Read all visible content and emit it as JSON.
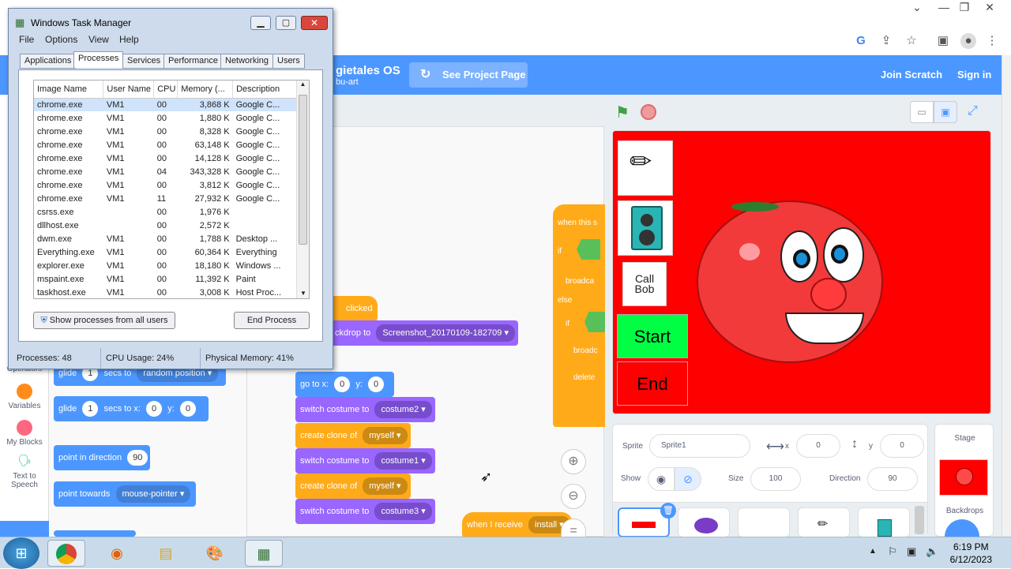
{
  "browser": {
    "toolbar_icons": [
      "google-icon",
      "share-icon",
      "star-icon",
      "sidebar-icon",
      "profile-icon",
      "menu-icon"
    ]
  },
  "scratch": {
    "project_title": "gietales OS",
    "project_author": "bu-art",
    "see_project": "See Project Page",
    "join": "Join Scratch",
    "signin": "Sign in",
    "categories": [
      {
        "label": "Operators",
        "color": "#59c059"
      },
      {
        "label": "Variables",
        "color": "#ff8c1a"
      },
      {
        "label": "My Blocks",
        "color": "#ff6680"
      },
      {
        "label": "Text to Speech",
        "color": "#0fbd8c"
      }
    ],
    "palette_blocks": {
      "glide1": {
        "label": "glide",
        "secs": "1",
        "secs_to": "secs to",
        "target": "random position"
      },
      "glide2": {
        "label": "glide",
        "secs": "1",
        "secs_to": "secs to x:",
        "x": "0",
        "y_label": "y:",
        "y": "0"
      },
      "point_dir": {
        "label": "point in direction",
        "value": "90"
      },
      "point_towards": {
        "label": "point towards",
        "target": "mouse-pointer"
      }
    },
    "script_blocks": {
      "clicked": "clicked",
      "backdrop_to": "ckdrop to",
      "backdrop_value": "Screenshot_20170109-182709",
      "goto": "go to x:",
      "goto_x": "0",
      "goto_y_label": "y:",
      "goto_y": "0",
      "switch1": "switch costume to",
      "switch1_val": "costume2",
      "clone1": "create clone of",
      "clone1_val": "myself",
      "switch2": "switch costume to",
      "switch2_val": "costume1",
      "clone2": "create clone of",
      "clone2_val": "myself",
      "switch3": "switch costume to",
      "switch3_val": "costume3",
      "when_receive": "when I receive",
      "when_receive_val": "install",
      "when_this": "when this s",
      "if1": "if",
      "broadcast1": "broadca",
      "else": "else",
      "if2": "if",
      "broadcast2": "broadc",
      "delete": "delete"
    },
    "stage": {
      "call_bob": "Call\nBob",
      "start": "Start",
      "end": "End"
    },
    "sprite_info": {
      "sprite_label": "Sprite",
      "sprite_name": "Sprite1",
      "x_label": "x",
      "x": "0",
      "y_label": "y",
      "y": "0",
      "show_label": "Show",
      "size_label": "Size",
      "size": "100",
      "direction_label": "Direction",
      "direction": "90"
    },
    "stage_pane": {
      "title": "Stage",
      "backdrops": "Backdrops"
    }
  },
  "task_manager": {
    "title": "Windows Task Manager",
    "menu": [
      "File",
      "Options",
      "View",
      "Help"
    ],
    "tabs": [
      "Applications",
      "Processes",
      "Services",
      "Performance",
      "Networking",
      "Users"
    ],
    "columns": [
      "Image Name",
      "User Name",
      "CPU",
      "Memory (...",
      "Description"
    ],
    "rows": [
      [
        "chrome.exe",
        "VM1",
        "00",
        "3,868 K",
        "Google C..."
      ],
      [
        "chrome.exe",
        "VM1",
        "00",
        "1,880 K",
        "Google C..."
      ],
      [
        "chrome.exe",
        "VM1",
        "00",
        "8,328 K",
        "Google C..."
      ],
      [
        "chrome.exe",
        "VM1",
        "00",
        "63,148 K",
        "Google C..."
      ],
      [
        "chrome.exe",
        "VM1",
        "00",
        "14,128 K",
        "Google C..."
      ],
      [
        "chrome.exe",
        "VM1",
        "04",
        "343,328 K",
        "Google C..."
      ],
      [
        "chrome.exe",
        "VM1",
        "00",
        "3,812 K",
        "Google C..."
      ],
      [
        "chrome.exe",
        "VM1",
        "11",
        "27,932 K",
        "Google C..."
      ],
      [
        "csrss.exe",
        "",
        "00",
        "1,976 K",
        ""
      ],
      [
        "dllhost.exe",
        "",
        "00",
        "2,572 K",
        ""
      ],
      [
        "dwm.exe",
        "VM1",
        "00",
        "1,788 K",
        "Desktop ..."
      ],
      [
        "Everything.exe",
        "VM1",
        "00",
        "60,364 K",
        "Everything"
      ],
      [
        "explorer.exe",
        "VM1",
        "00",
        "18,180 K",
        "Windows ..."
      ],
      [
        "mspaint.exe",
        "VM1",
        "00",
        "11,392 K",
        "Paint"
      ],
      [
        "taskhost.exe",
        "VM1",
        "00",
        "3,008 K",
        "Host Proc..."
      ]
    ],
    "show_all": "Show processes from all users",
    "end_process": "End Process",
    "status_processes": "Processes: 48",
    "status_cpu": "CPU Usage: 24%",
    "status_memory": "Physical Memory: 41%"
  },
  "taskbar": {
    "time": "6:19 PM",
    "date": "6/12/2023"
  }
}
